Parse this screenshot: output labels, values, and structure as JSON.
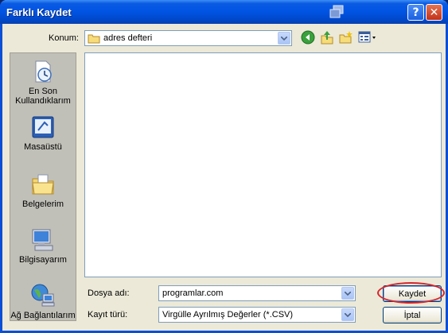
{
  "window": {
    "title": "Farklı Kaydet",
    "help_label": "?",
    "close_label": "✕"
  },
  "location": {
    "label": "Konum:",
    "value": "adres defteri"
  },
  "toolbar": {
    "icons": [
      "back-icon",
      "up-folder-icon",
      "new-folder-icon",
      "view-menu-icon"
    ]
  },
  "places": [
    {
      "label": "En Son Kullandıklarım",
      "icon": "recent-documents-icon"
    },
    {
      "label": "Masaüstü",
      "icon": "desktop-icon"
    },
    {
      "label": "Belgelerim",
      "icon": "my-documents-icon"
    },
    {
      "label": "Bilgisayarım",
      "icon": "my-computer-icon"
    },
    {
      "label": "Ağ Bağlantılarım",
      "icon": "network-places-icon"
    }
  ],
  "filename": {
    "label": "Dosya adı:",
    "value": "programlar.com"
  },
  "filetype": {
    "label": "Kayıt türü:",
    "value": "Virgülle Ayrılmış Değerler (*.CSV)"
  },
  "buttons": {
    "save": "Kaydet",
    "cancel": "İptal"
  },
  "colors": {
    "titlebar": "#0054e3",
    "highlight_ellipse": "#d6252a",
    "dialog_bg": "#ece9d8"
  }
}
